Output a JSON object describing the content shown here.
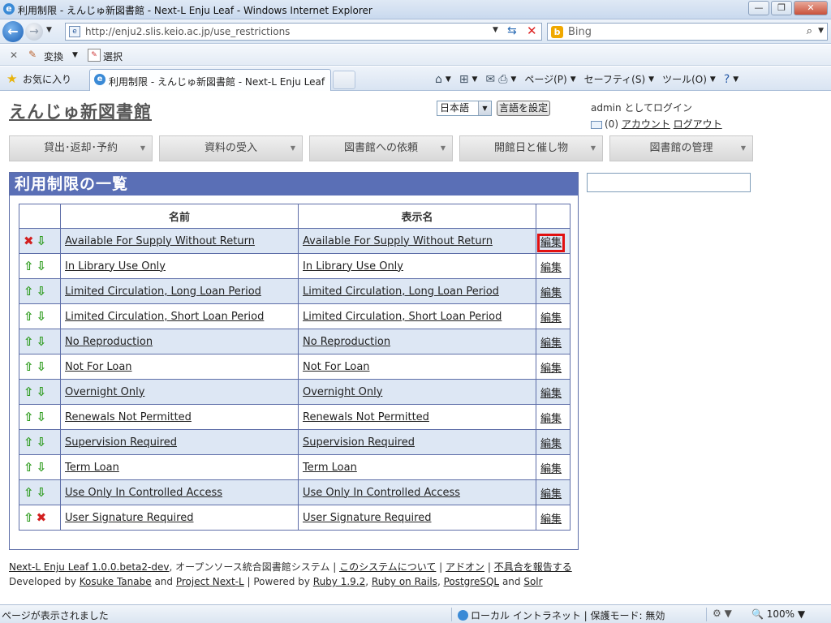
{
  "window": {
    "title": "利用制限 - えんじゅ新図書館 - Next-L Enju Leaf - Windows Internet Explorer",
    "ie_letter": "e",
    "minimize": "—",
    "restore": "❐",
    "close": "✕"
  },
  "addressbar": {
    "back": "←",
    "url": "http://enju2.slis.keio.ac.jp/use_restrictions",
    "search_provider": "Bing"
  },
  "commandbar": {
    "convert_label": "変換",
    "select_label": "選択",
    "favorites_label": "お気に入り",
    "tab_title": "利用制限 - えんじゅ新図書館 - Next-L Enju Leaf",
    "page_menu": "ページ(P)",
    "safety_menu": "セーフティ(S)",
    "tools_menu": "ツール(O)"
  },
  "site": {
    "title": "えんじゅ新図書館",
    "language": "日本語",
    "language_button": "言語を設定",
    "login_status": "admin としてログイン",
    "message_count": "(0)",
    "account_link": "アカウント",
    "logout_link": "ログアウト"
  },
  "menu": [
    {
      "label": "貸出･返却･予約"
    },
    {
      "label": "資料の受入"
    },
    {
      "label": "図書館への依頼"
    },
    {
      "label": "開館日と催し物"
    },
    {
      "label": "図書館の管理"
    }
  ],
  "panel": {
    "heading": "利用制限の一覧",
    "col_name": "名前",
    "col_display_name": "表示名",
    "edit_label": "編集"
  },
  "rows": [
    {
      "name": "Available For Supply Without Return",
      "display_name": "Available For Supply Without Return",
      "can_up": false,
      "can_down": true
    },
    {
      "name": "In Library Use Only",
      "display_name": "In Library Use Only",
      "can_up": true,
      "can_down": true
    },
    {
      "name": "Limited Circulation, Long Loan Period",
      "display_name": "Limited Circulation, Long Loan Period",
      "can_up": true,
      "can_down": true
    },
    {
      "name": "Limited Circulation, Short Loan Period",
      "display_name": "Limited Circulation, Short Loan Period",
      "can_up": true,
      "can_down": true
    },
    {
      "name": "No Reproduction",
      "display_name": "No Reproduction",
      "can_up": true,
      "can_down": true
    },
    {
      "name": "Not For Loan",
      "display_name": "Not For Loan",
      "can_up": true,
      "can_down": true
    },
    {
      "name": "Overnight Only",
      "display_name": "Overnight Only",
      "can_up": true,
      "can_down": true
    },
    {
      "name": "Renewals Not Permitted",
      "display_name": "Renewals Not Permitted",
      "can_up": true,
      "can_down": true
    },
    {
      "name": "Supervision Required",
      "display_name": "Supervision Required",
      "can_up": true,
      "can_down": true
    },
    {
      "name": "Term Loan",
      "display_name": "Term Loan",
      "can_up": true,
      "can_down": true
    },
    {
      "name": "Use Only In Controlled Access",
      "display_name": "Use Only In Controlled Access",
      "can_up": true,
      "can_down": true
    },
    {
      "name": "User Signature Required",
      "display_name": "User Signature Required",
      "can_up": true,
      "can_down": false
    }
  ],
  "footer": {
    "app_version": "Next-L Enju Leaf 1.0.0.beta2-dev",
    "app_desc": ", オープンソース統合図書館システム",
    "about": "このシステムについて",
    "addon": "アドオン",
    "report": "不具合を報告する",
    "developed_by": "Developed by",
    "dev_name": "Kosuke Tanabe",
    "and1": "and",
    "project": "Project Next-L",
    "powered_by": "Powered by",
    "ruby": "Ruby 1.9.2",
    "rails": "Ruby on Rails",
    "postgres": "PostgreSQL",
    "and2": "and",
    "solr": "Solr"
  },
  "status": {
    "message": "ページが表示されました",
    "zone": "ローカル イントラネット | 保護モード: 無効",
    "zoom": "100%"
  },
  "colors": {
    "panel_header": "#5a6fb6",
    "row_alt": "#dde7f4",
    "arrow": "#2a9a1a",
    "disabled_x": "#d21f1f",
    "highlight": "#e21010"
  }
}
